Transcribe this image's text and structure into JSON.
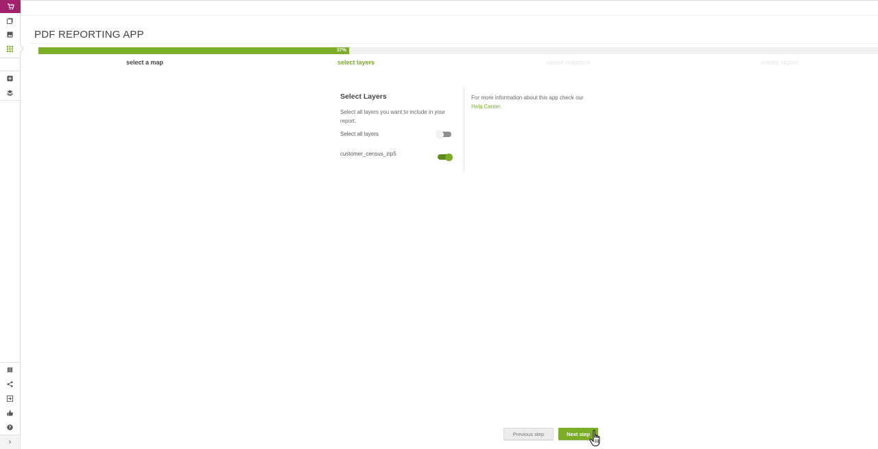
{
  "app": {
    "title": "PDF REPORTING APP"
  },
  "progress": {
    "value": 0.37,
    "label": "37%"
  },
  "steps": [
    {
      "label": "select a map",
      "state": "done"
    },
    {
      "label": "select layers",
      "state": "current"
    },
    {
      "label": "select columns",
      "state": "future"
    },
    {
      "label": "create report",
      "state": "future"
    }
  ],
  "panel": {
    "title": "Select Layers",
    "description": "Select all layers you want to include in your report.",
    "select_all_label": "Select all layers",
    "select_all_on": false,
    "layers": [
      {
        "name": "customer_census_zip5",
        "on": true
      }
    ]
  },
  "info": {
    "text": "For more information about this app check our",
    "link": "Help Center",
    "suffix": "."
  },
  "footer": {
    "prev_label": "Previous step",
    "next_label": "Next step"
  },
  "colors": {
    "accent": "#7cad27",
    "brand": "#a3216a"
  },
  "sidebar": {
    "top_icons": [
      "cart-icon",
      "gallery-icon",
      "image-icon",
      "apps-icon"
    ],
    "mid_icons": [
      "add-icon",
      "layers-icon"
    ],
    "bottom_icons": [
      "map-icon",
      "share-icon",
      "export-icon",
      "thumbs-up-icon",
      "help-icon",
      "chevron-right-icon"
    ]
  }
}
